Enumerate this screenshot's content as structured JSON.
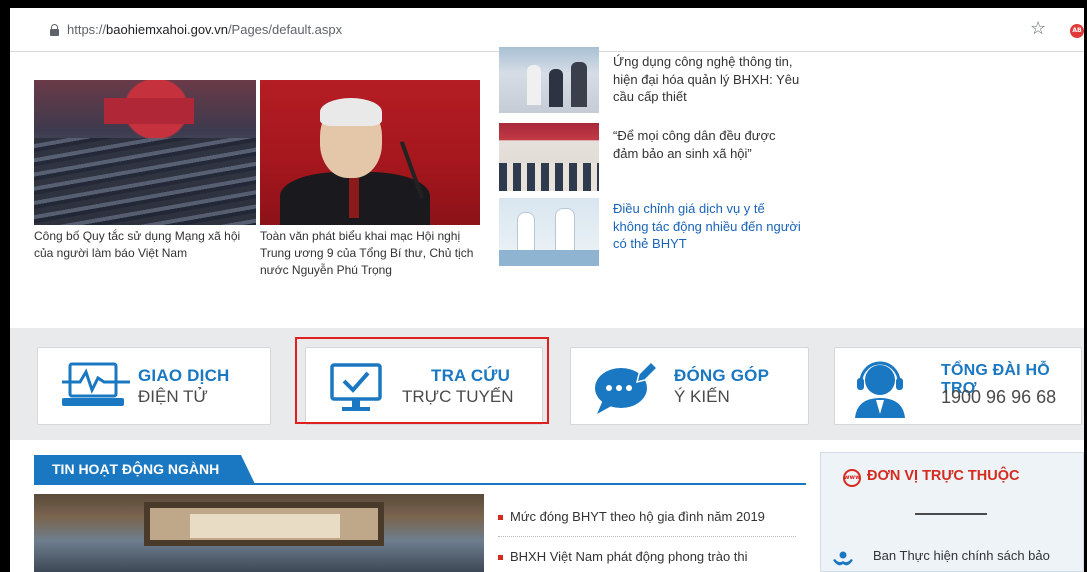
{
  "browser": {
    "url_scheme": "https://",
    "url_host": "baohiemxahoi.gov.vn",
    "url_path": "/Pages/default.aspx",
    "ext_badge": "AB"
  },
  "news": {
    "featured": [
      {
        "caption": "Công bố Quy tắc sử dụng Mạng xã hội của người làm báo Việt Nam"
      },
      {
        "caption": "Toàn văn phát biểu khai mạc Hội nghị Trung ương 9 của Tổng Bí thư, Chủ tịch nước Nguyễn Phú Trọng"
      }
    ],
    "side": [
      {
        "title": "Ứng dụng công nghệ thông tin, hiện đại hóa quản lý BHXH: Yêu cầu cấp thiết"
      },
      {
        "title": "“Để mọi công dân đều được đảm bảo an sinh xã hội”"
      },
      {
        "title": "Điều chỉnh giá dịch vụ y tế không tác động nhiều đến người có thẻ BHYT"
      }
    ]
  },
  "services": [
    {
      "line1": "GIAO DỊCH",
      "line2": "ĐIỆN TỬ",
      "icon": "laptop-pulse-icon"
    },
    {
      "line1": "TRA CỨU",
      "line2": "TRỰC TUYẾN",
      "icon": "monitor-check-icon"
    },
    {
      "line1": "ĐÓNG GÓP",
      "line2": "Ý KIẾN",
      "icon": "speech-bubble-pen-icon"
    },
    {
      "line1": "TỔNG ĐÀI HỖ TRỢ",
      "line2": "1900 96 96 68",
      "icon": "headset-operator-icon"
    }
  ],
  "section": {
    "title": "TIN HOẠT ĐỘNG NGÀNH",
    "items": [
      "Mức đóng BHYT theo hộ gia đình năm 2019",
      "BHXH Việt Nam phát động phong trào thi"
    ]
  },
  "units": {
    "title": "ĐƠN VỊ TRỰC THUỘC",
    "first_item": "Ban Thực hiện chính sách bảo"
  },
  "colors": {
    "accent": "#1a78c2",
    "highlight": "#e02020",
    "brand_red": "#d52b1e"
  }
}
